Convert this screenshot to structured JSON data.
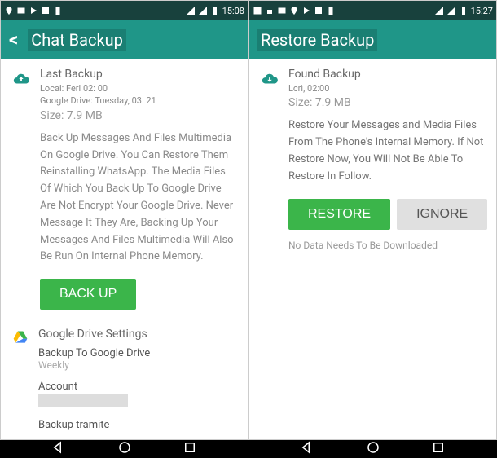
{
  "left": {
    "status": {
      "time": "15:08"
    },
    "appbar": {
      "title": "Chat Backup"
    },
    "backup": {
      "heading": "Last Backup",
      "line1": "Local: Feri 02: 00",
      "line2": "Google Drive: Tuesday, 03: 21",
      "size": "Size: 7.9 MB",
      "desc": "Back Up Messages And Files Multimedia On Google Drive. You Can Restore Them Reinstalling WhatsApp. The Media Files Of Which You Back Up To Google Drive Are Not Encrypt Your Google Drive. Never Message It They Are, Backing Up Your Messages And Files Multimedia Will Also Be Run On Internal Phone Memory.",
      "button": "BACK UP"
    },
    "gdrive": {
      "heading": "Google Drive Settings",
      "freq_label": "Backup To Google Drive",
      "freq_value": "Weekly",
      "account_label": "Account",
      "tramite_label": "Backup tramite"
    }
  },
  "right": {
    "status": {
      "time": "15:27"
    },
    "appbar": {
      "title": "Restore Backup"
    },
    "found": {
      "heading": "Found Backup",
      "line1": "Lcrì, 02:00",
      "size": "Size: 7.9 MB",
      "desc": "Restore Your Messages and Media Files From The Phone's Internal Memory. If Not Restore Now, You Will Not Be Able To Restore In Follow.",
      "restore": "Restore",
      "ignore": "IGNORE",
      "note": "No Data Needs To Be Downloaded"
    }
  }
}
